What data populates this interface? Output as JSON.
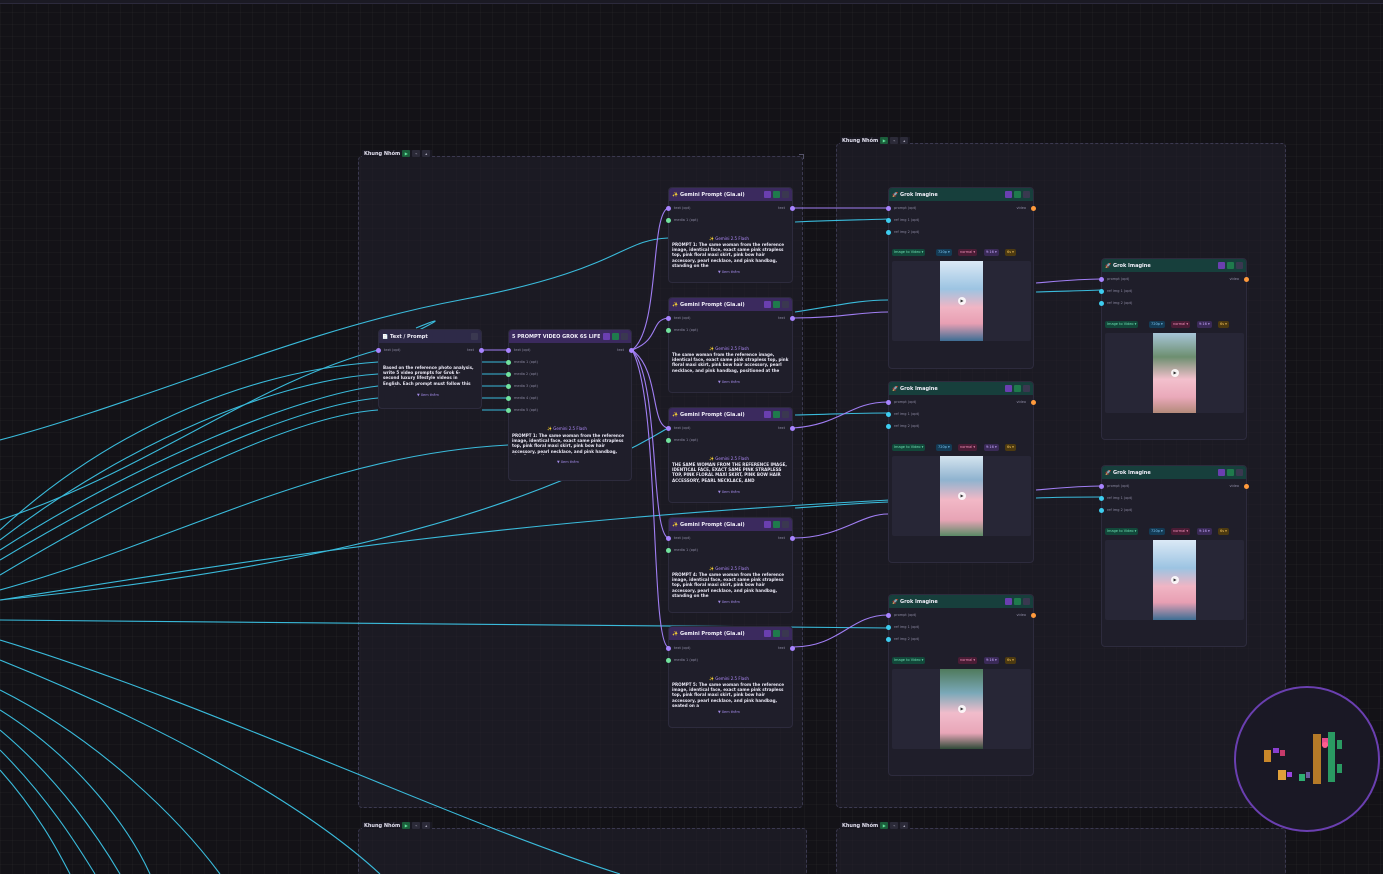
{
  "groups": [
    {
      "id": "g1",
      "title": "Khung Nhóm"
    },
    {
      "id": "g2",
      "title": "Khung Nhóm"
    },
    {
      "id": "g3",
      "title": "Khung Nhóm"
    },
    {
      "id": "g4",
      "title": "Khung Nhóm"
    }
  ],
  "text_prompt": {
    "title": "📄 Text / Prompt",
    "port_in": "text (opt)",
    "port_out": "text",
    "body": "Based on the reference photo analysis, write 5 video prompts for Grok 6-second luxury lifestyle videos in English. Each prompt must follow this exact",
    "see_more": "▼ Xem thêm"
  },
  "splitter": {
    "title": "5 PROMPT VIDEO GROK 6S LIFESTYLE",
    "port_in": "text (opt)",
    "port_out": "text",
    "media_ports": [
      "media 1 (opt)",
      "media 2 (opt)",
      "media 3 (opt)",
      "media 4 (opt)",
      "media 5 (opt)"
    ],
    "model": "✨ Gemini 2.5 Flash",
    "body": "PROMPT 1: The same woman from the reference image, identical face, exact same pink strapless top, pink floral maxi skirt, pink bow hair accessory, pearl necklace, and pink handbag, standing on the",
    "see_more": "▼ Xem thêm"
  },
  "gemini_nodes": [
    {
      "title": "✨ Gemini Prompt (Gia.ai)",
      "port_text": "text (opt)",
      "port_media": "media 1 (opt)",
      "port_out": "text",
      "model": "✨ Gemini 2.5 Flash",
      "body": "PROMPT 1: The same woman from the reference image, identical face, exact same pink strapless top, pink floral maxi skirt, pink bow hair accessory, pearl necklace, and pink handbag, standing on the",
      "see_more": "▼ Xem thêm"
    },
    {
      "title": "✨ Gemini Prompt (Gia.ai)",
      "port_text": "text (opt)",
      "port_media": "media 1 (opt)",
      "port_out": "text",
      "model": "✨ Gemini 2.5 Flash",
      "body": "The same woman from the reference image, identical face, exact same pink strapless top, pink floral maxi skirt, pink bow hair accessory, pearl necklace, and pink handbag, positioned at the",
      "see_more": "▼ Xem thêm"
    },
    {
      "title": "✨ Gemini Prompt (Gia.ai)",
      "port_text": "text (opt)",
      "port_media": "media 1 (opt)",
      "port_out": "text",
      "model": "✨ Gemini 2.5 Flash",
      "body": "THE SAME WOMAN FROM THE REFERENCE IMAGE, IDENTICAL FACE, EXACT SAME PINK STRAPLESS TOP, PINK FLORAL MAXI SKIRT, PINK BOW HAIR ACCESSORY, PEARL NECKLACE, AND",
      "see_more": "▼ Xem thêm"
    },
    {
      "title": "✨ Gemini Prompt (Gia.ai)",
      "port_text": "text (opt)",
      "port_media": "media 1 (opt)",
      "port_out": "text",
      "model": "✨ Gemini 2.5 Flash",
      "body": "PROMPT 4: The same woman from the reference image, identical face, exact same pink strapless top, pink floral maxi skirt, pink bow hair accessory, pearl necklace, and pink handbag, standing on the",
      "see_more": "▼ Xem thêm"
    },
    {
      "title": "✨ Gemini Prompt (Gia.ai)",
      "port_text": "text (opt)",
      "port_media": "media 1 (opt)",
      "port_out": "text",
      "model": "✨ Gemini 2.5 Flash",
      "body": "PROMPT 5: The same woman from the reference image, identical face, exact same pink strapless top, pink floral maxi skirt, pink bow hair accessory, pearl necklace, and pink handbag, seated on a",
      "see_more": "▼ Xem thêm"
    }
  ],
  "grok_nodes": [
    {
      "title": "🚀 Grok Imagine",
      "port_prompt": "prompt (opt)",
      "port_ref1": "ref img 1 (opt)",
      "port_ref2": "ref img 2 (opt)",
      "port_out": "video",
      "chips": [
        "Image to Video ▾",
        "720p ▾",
        "normal ▾",
        "9:16 ▾",
        "6s ▾"
      ]
    },
    {
      "title": "🚀 Grok Imagine",
      "port_prompt": "prompt (opt)",
      "port_ref1": "ref img 1 (opt)",
      "port_ref2": "ref img 2 (opt)",
      "port_out": "video",
      "chips": [
        "Image to Video ▾",
        "720p ▾",
        "normal ▾",
        "9:16 ▾",
        "6s ▾"
      ]
    },
    {
      "title": "🚀 Grok Imagine",
      "port_prompt": "prompt (opt)",
      "port_ref1": "ref img 1 (opt)",
      "port_ref2": "ref img 2 (opt)",
      "port_out": "video",
      "chips": [
        "Image to Video ▾",
        "normal ▾",
        "9:16 ▾",
        "6s ▾"
      ]
    },
    {
      "title": "🚀 Grok Imagine",
      "port_prompt": "prompt (opt)",
      "port_ref1": "ref img 1 (opt)",
      "port_ref2": "ref img 2 (opt)",
      "port_out": "video",
      "chips": [
        "Image to Video ▾",
        "720p ▾",
        "normal ▾",
        "9:16 ▾",
        "6s ▾"
      ]
    },
    {
      "title": "🚀 Grok Imagine",
      "port_prompt": "prompt (opt)",
      "port_ref1": "ref img 1 (opt)",
      "port_ref2": "ref img 2 (opt)",
      "port_out": "video",
      "chips": [
        "Image to Video ▾",
        "720p ▾",
        "normal ▾",
        "9:16 ▾",
        "6s ▾"
      ]
    }
  ],
  "colors": {
    "canvas": "#131217",
    "wire_image": "#3ecdf0",
    "wire_text": "#a884ff",
    "port_video": "#ff9a3c",
    "port_media": "#72e39e",
    "minimap_border": "#6a3fb0"
  },
  "icons": {
    "play": "▶",
    "text_node": "document-icon",
    "gemini": "sparkle-icon",
    "grok": "rocket-icon"
  }
}
